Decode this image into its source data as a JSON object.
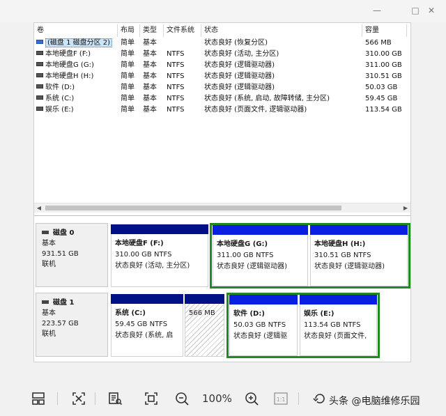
{
  "window": {
    "min_icon": "minimize-icon",
    "max_icon": "maximize-icon",
    "close_icon": "close-icon"
  },
  "volume_table": {
    "columns": [
      "卷",
      "布局",
      "类型",
      "文件系统",
      "状态",
      "容量"
    ],
    "rows": [
      {
        "volume": "(磁盘 1 磁盘分区 2)",
        "layout": "简单",
        "type": "基本",
        "fs": "",
        "status": "状态良好 (恢复分区)",
        "capacity": "566 MB",
        "selected": true
      },
      {
        "volume": "本地硬盘F (F:)",
        "layout": "简单",
        "type": "基本",
        "fs": "NTFS",
        "status": "状态良好 (活动, 主分区)",
        "capacity": "310.00 GB"
      },
      {
        "volume": "本地硬盘G (G:)",
        "layout": "简单",
        "type": "基本",
        "fs": "NTFS",
        "status": "状态良好 (逻辑驱动器)",
        "capacity": "311.00 GB"
      },
      {
        "volume": "本地硬盘H (H:)",
        "layout": "简单",
        "type": "基本",
        "fs": "NTFS",
        "status": "状态良好 (逻辑驱动器)",
        "capacity": "310.51 GB"
      },
      {
        "volume": "软件 (D:)",
        "layout": "简单",
        "type": "基本",
        "fs": "NTFS",
        "status": "状态良好 (逻辑驱动器)",
        "capacity": "50.03 GB"
      },
      {
        "volume": "系统 (C:)",
        "layout": "简单",
        "type": "基本",
        "fs": "NTFS",
        "status": "状态良好 (系统, 启动, 故障转储, 主分区)",
        "capacity": "59.45 GB"
      },
      {
        "volume": "娱乐 (E:)",
        "layout": "简单",
        "type": "基本",
        "fs": "NTFS",
        "status": "状态良好 (页面文件, 逻辑驱动器)",
        "capacity": "113.54 GB"
      }
    ]
  },
  "disks": [
    {
      "name": "磁盘 0",
      "kind": "基本",
      "size": "931.51 GB",
      "state": "联机",
      "partitions": [
        {
          "name": "本地硬盘F (F:)",
          "size": "310.00 GB NTFS",
          "status": "状态良好 (活动, 主分区)",
          "bar": "primary"
        },
        {
          "name": "本地硬盘G (G:)",
          "size": "311.00 GB NTFS",
          "status": "状态良好 (逻辑驱动器)",
          "bar": "logical"
        },
        {
          "name": "本地硬盘H (H:)",
          "size": "310.51 GB NTFS",
          "status": "状态良好 (逻辑驱动器)",
          "bar": "logical"
        }
      ]
    },
    {
      "name": "磁盘 1",
      "kind": "基本",
      "size": "223.57 GB",
      "state": "联机",
      "partitions": [
        {
          "name": "系统 (C:)",
          "size": "59.45 GB NTFS",
          "status": "状态良好 (系统, 启",
          "bar": "primary"
        },
        {
          "name": "",
          "size": "566 MB",
          "status": "",
          "bar": "primary",
          "hatched": true
        },
        {
          "name": "软件 (D:)",
          "size": "50.03 GB NTFS",
          "status": "状态良好 (逻辑驱",
          "bar": "logical"
        },
        {
          "name": "娱乐 (E:)",
          "size": "113.54 GB NTFS",
          "status": "状态良好 (页面文件,",
          "bar": "logical"
        }
      ]
    }
  ],
  "colors": {
    "primary_bar": "#001188",
    "logical_bar": "#0a1fe0",
    "extended_border": "#1f8a1f"
  },
  "toolbar": {
    "zoom": "100%",
    "watermark": "头条 @电脑维修乐园"
  }
}
